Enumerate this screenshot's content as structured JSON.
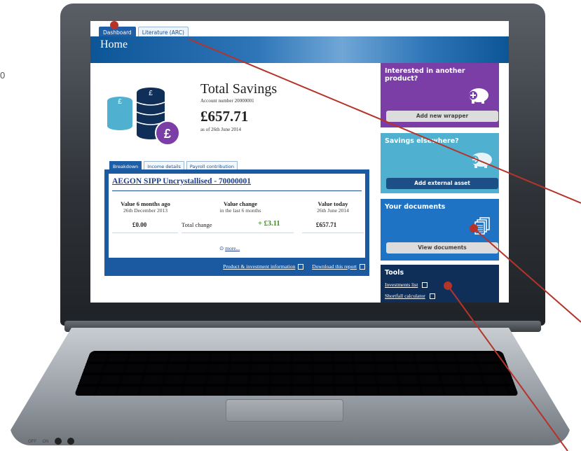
{
  "tabs": [
    {
      "label": "Dashboard",
      "active": true
    },
    {
      "label": "Literature (ARC)",
      "active": false
    }
  ],
  "page_title": "Home",
  "summary": {
    "title": "Total Savings",
    "account_number": "Account number 20000001",
    "amount": "£657.71",
    "as_of": "as of 26th June 2014"
  },
  "subtabs": [
    {
      "label": "Breakdown",
      "active": true
    },
    {
      "label": "Income details",
      "active": false
    },
    {
      "label": "Payroll contribution",
      "active": false
    }
  ],
  "product": {
    "name": "AEGON SIPP Uncrystallised - 70000001",
    "columns": [
      {
        "title": "Value 6 months ago",
        "subtitle": "26th December 2013"
      },
      {
        "title": "Value change",
        "subtitle": "in the last 6 months"
      },
      {
        "title": "Value today",
        "subtitle": "26th June 2014"
      }
    ],
    "row": {
      "value_6_months_ago": "£0.00",
      "change_label": "Total change",
      "change_value": "+ £3.11",
      "value_today": "£657.71"
    },
    "more_link": "more..."
  },
  "panel_links": {
    "product_info": "Product & investment information",
    "download": "Download this report"
  },
  "widgets": {
    "another_product": {
      "title": "Interested in another product?",
      "button": "Add new wrapper"
    },
    "savings_elsewhere": {
      "title": "Savings elsewhere?",
      "button": "Add external asset"
    },
    "documents": {
      "title": "Your documents",
      "button": "View documents"
    },
    "tools": {
      "title": "Tools",
      "links": [
        "Investments list",
        "Shortfall calculator"
      ]
    }
  },
  "laptop_labels": {
    "left": "OFF",
    "mid": "ON",
    "right": "0"
  },
  "colors": {
    "banner_blue": "#0c5597",
    "purple": "#7a3ea6",
    "teal": "#4fb0d0",
    "docs_blue": "#1f73c4",
    "navy": "#0f2e58",
    "annotation_red": "#b5342a",
    "positive_green": "#3c8d1c"
  }
}
